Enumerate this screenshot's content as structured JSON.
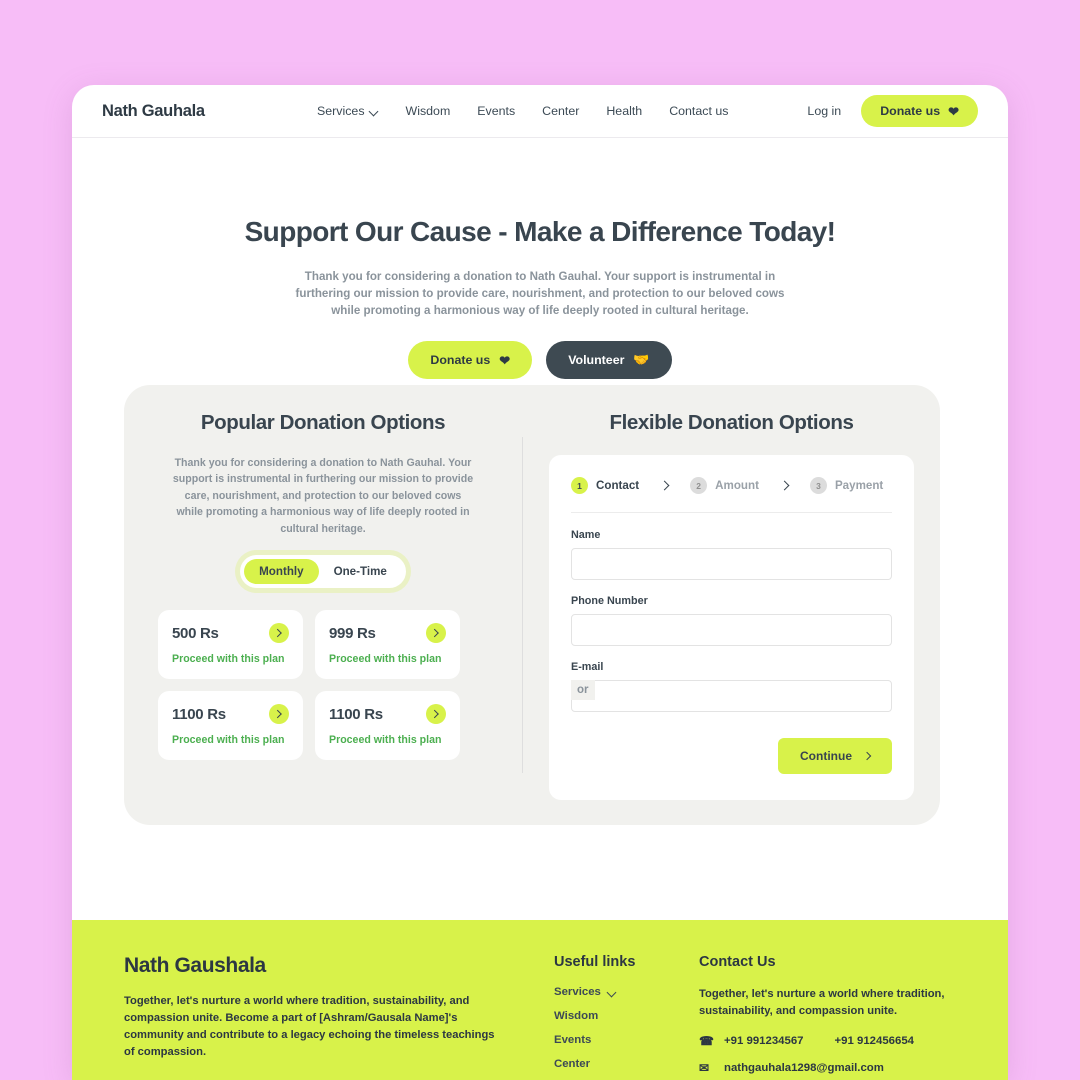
{
  "theme": {
    "page_bg": "#f7bdf7",
    "accent_lime": "#d8f24a",
    "dark": "#39454f",
    "green": "#4caf50",
    "panel_bg": "#f1f1ee"
  },
  "header": {
    "brand": "Nath Gauhala",
    "nav": [
      {
        "label": "Services",
        "has_dropdown": true
      },
      {
        "label": "Wisdom",
        "has_dropdown": false
      },
      {
        "label": "Events",
        "has_dropdown": false
      },
      {
        "label": "Center",
        "has_dropdown": false
      },
      {
        "label": "Health",
        "has_dropdown": false
      },
      {
        "label": "Contact us",
        "has_dropdown": false
      }
    ],
    "login_label": "Log in",
    "donate_label": "Donate us",
    "donate_icon": "heart-icon"
  },
  "hero": {
    "title": "Support Our Cause - Make a Difference Today!",
    "description": "Thank you for considering a donation to Nath Gauhal. Your support is instrumental in furthering our mission to provide care, nourishment, and protection to our beloved cows while promoting a harmonious way of life deeply rooted in cultural heritage.",
    "primary_label": "Donate us",
    "primary_icon": "heart-icon",
    "secondary_label": "Volunteer",
    "secondary_icon": "volunteer-hand-icon"
  },
  "popular": {
    "title": "Popular Donation Options",
    "description": "Thank you for considering a donation to Nath Gauhal. Your support is instrumental in furthering our mission to provide care, nourishment, and protection to our beloved cows while promoting a harmonious way of life deeply rooted in cultural heritage.",
    "toggle": {
      "options": [
        "Monthly",
        "One-Time"
      ],
      "selected": "Monthly"
    },
    "plans": [
      {
        "amount": "500 Rs",
        "cta": "Proceed with this plan"
      },
      {
        "amount": "999 Rs",
        "cta": "Proceed with this plan"
      },
      {
        "amount": "1100 Rs",
        "cta": "Proceed with this plan"
      },
      {
        "amount": "1100 Rs",
        "cta": "Proceed with this plan"
      }
    ]
  },
  "divider_label": "or",
  "flexible": {
    "title": "Flexible Donation Options",
    "steps": [
      {
        "number": "1",
        "label": "Contact",
        "active": true
      },
      {
        "number": "2",
        "label": "Amount",
        "active": false
      },
      {
        "number": "3",
        "label": "Payment",
        "active": false
      }
    ],
    "fields": [
      {
        "label": "Name",
        "value": "",
        "placeholder": ""
      },
      {
        "label": "Phone Number",
        "value": "",
        "placeholder": ""
      },
      {
        "label": "E-mail",
        "value": "",
        "placeholder": ""
      }
    ],
    "continue_label": "Continue"
  },
  "footer": {
    "brand": "Nath Gaushala",
    "brand_text": "Together, let's nurture a world where tradition, sustainability, and compassion unite. Become a part of [Ashram/Gausala Name]'s community and contribute to a legacy echoing the timeless teachings of compassion.",
    "links_heading": "Useful links",
    "links": [
      {
        "label": "Services",
        "has_dropdown": true
      },
      {
        "label": "Wisdom",
        "has_dropdown": false
      },
      {
        "label": "Events",
        "has_dropdown": false
      },
      {
        "label": "Center",
        "has_dropdown": false
      }
    ],
    "contact_heading": "Contact Us",
    "contact_text": "Together, let's nurture a world where tradition, sustainability, and compassion unite.",
    "phone_icon": "phone-icon",
    "phone_1": "+91 991234567",
    "phone_2": "+91 912456654",
    "email_icon": "envelope-icon",
    "email": "nathgauhala1298@gmail.com"
  }
}
